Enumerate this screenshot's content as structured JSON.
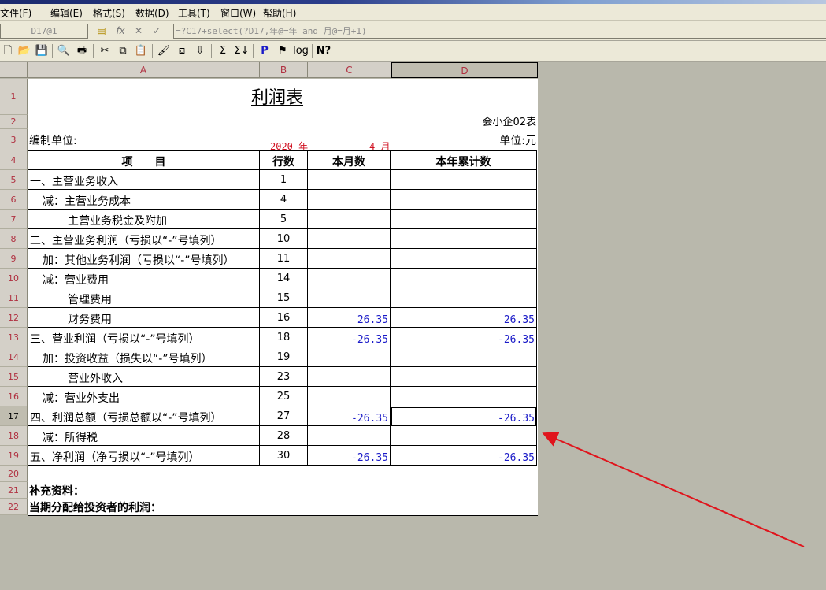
{
  "titlebar": {
    "title": ""
  },
  "menu": [
    "文件(F)",
    "编辑(E)",
    "格式(S)",
    "数据(D)",
    "工具(T)",
    "窗口(W)",
    "帮助(H)"
  ],
  "formula_bar": {
    "cell_ref": "D17@1",
    "formula": "=?C17+select(?D17,年@=年 and 月@=月+1)"
  },
  "toolbar_icons": [
    "new-icon",
    "open-icon",
    "save-icon",
    "print-preview-icon",
    "print-icon",
    "cut-icon",
    "copy-icon",
    "paste-icon",
    "format-painter-icon",
    "insert-icon",
    "sort-icon",
    "sum-icon",
    "subtotal-icon",
    "p-icon",
    "bookmark-icon",
    "log-icon",
    "help-icon"
  ],
  "toolbar_text": {
    "p": "P",
    "log": "log",
    "help": "N?"
  },
  "columns": [
    "A",
    "B",
    "C",
    "D"
  ],
  "rows": [
    "1",
    "2",
    "3",
    "4",
    "5",
    "6",
    "7",
    "8",
    "9",
    "10",
    "11",
    "12",
    "13",
    "14",
    "15",
    "16",
    "17",
    "18",
    "19",
    "20",
    "21",
    "22"
  ],
  "report": {
    "title": "利润表",
    "form_no": "会小企02表",
    "compiler_label": "编制单位:",
    "year": "2020 年",
    "month": "4 月",
    "unit": "单位:元",
    "headers": [
      "项　　目",
      "行数",
      "本月数",
      "本年累计数"
    ],
    "lines": [
      {
        "item": "一、主营业务收入",
        "no": "1",
        "month": "",
        "ytd": "",
        "indent": 0
      },
      {
        "item": "减：主营业务成本",
        "no": "4",
        "month": "",
        "ytd": "",
        "indent": 1
      },
      {
        "item": "主营业务税金及附加",
        "no": "5",
        "month": "",
        "ytd": "",
        "indent": 2
      },
      {
        "item": "二、主营业务利润（亏损以“-”号填列）",
        "no": "10",
        "month": "",
        "ytd": "",
        "indent": 0
      },
      {
        "item": "加：其他业务利润（亏损以“-”号填列）",
        "no": "11",
        "month": "",
        "ytd": "",
        "indent": 1
      },
      {
        "item": "减：营业费用",
        "no": "14",
        "month": "",
        "ytd": "",
        "indent": 1
      },
      {
        "item": "管理费用",
        "no": "15",
        "month": "",
        "ytd": "",
        "indent": 2
      },
      {
        "item": "财务费用",
        "no": "16",
        "month": "26.35",
        "ytd": "26.35",
        "indent": 2
      },
      {
        "item": "三、营业利润（亏损以“-”号填列）",
        "no": "18",
        "month": "-26.35",
        "ytd": "-26.35",
        "indent": 0
      },
      {
        "item": "加：投资收益（损失以“-”号填列）",
        "no": "19",
        "month": "",
        "ytd": "",
        "indent": 1
      },
      {
        "item": "营业外收入",
        "no": "23",
        "month": "",
        "ytd": "",
        "indent": 2
      },
      {
        "item": "减：营业外支出",
        "no": "25",
        "month": "",
        "ytd": "",
        "indent": 1
      },
      {
        "item": "四、利润总额（亏损总额以“-”号填列）",
        "no": "27",
        "month": "-26.35",
        "ytd": "-26.35",
        "indent": 0
      },
      {
        "item": "减：所得税",
        "no": "28",
        "month": "",
        "ytd": "",
        "indent": 1
      },
      {
        "item": "五、净利润（净亏损以“-”号填列）",
        "no": "30",
        "month": "-26.35",
        "ytd": "-26.35",
        "indent": 0
      }
    ],
    "supplement": "补充资料：",
    "distribution": "当期分配给投资者的利润："
  },
  "colors": {
    "accent_arrow": "#e0141c",
    "number": "#1a1ac8",
    "header_text": "#b03040"
  }
}
